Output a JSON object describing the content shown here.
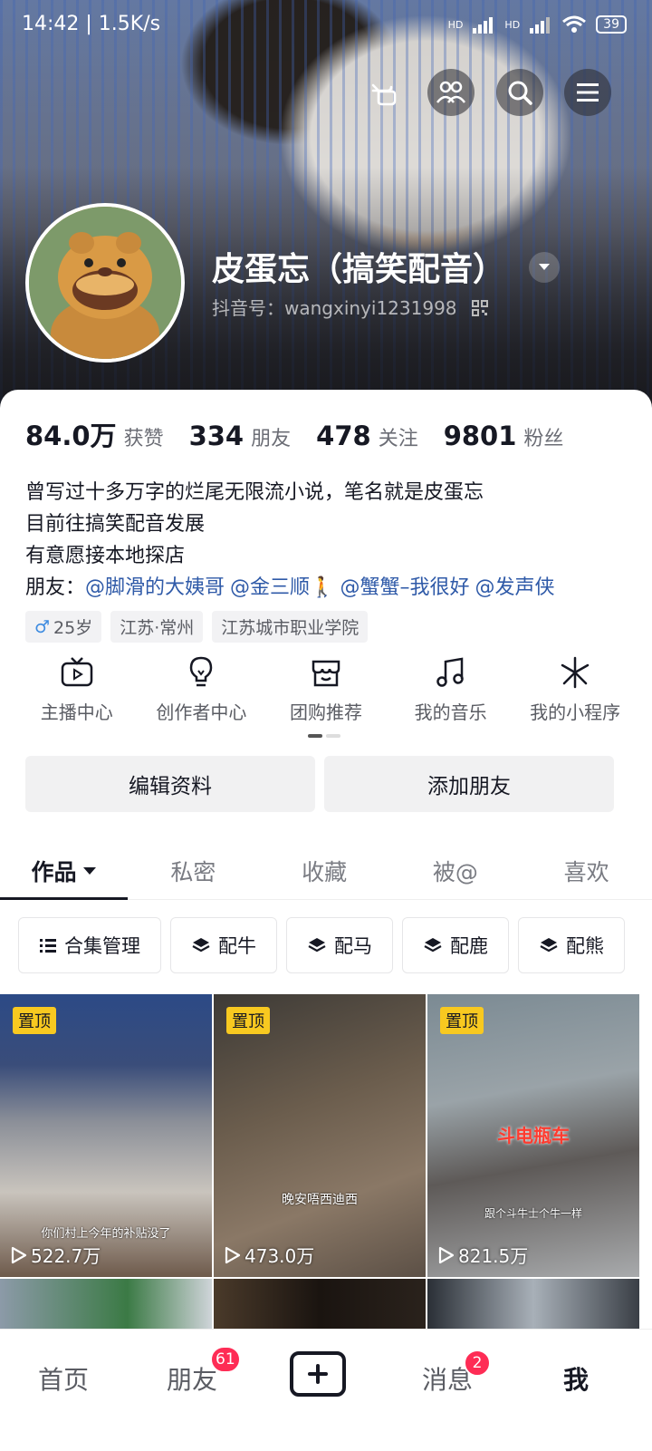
{
  "status_bar": {
    "time": "14:42 | 1.5K/s",
    "battery": "39",
    "net1": "HD",
    "net2": "HD"
  },
  "profile": {
    "name": "皮蛋忘（搞笑配音）",
    "douyin_id": "抖音号：wangxinyi1231998"
  },
  "stats": [
    {
      "value": "84.0万",
      "label": "获赞"
    },
    {
      "value": "334",
      "label": "朋友"
    },
    {
      "value": "478",
      "label": "关注"
    },
    {
      "value": "9801",
      "label": "粉丝"
    }
  ],
  "bio": {
    "line1": "曾写过十多万字的烂尾无限流小说，笔名就是皮蛋忘",
    "line2": "目前往搞笑配音发展",
    "line3": "有意愿接本地探店",
    "friends_label": "朋友：",
    "mentions": [
      "@脚滑的大姨哥",
      "@金三顺🚶",
      "@蟹蟹–我很好",
      "@发声侠"
    ]
  },
  "tags": {
    "age": "25岁",
    "location": "江苏·常州",
    "school": "江苏城市职业学院"
  },
  "shortcuts": [
    "主播中心",
    "创作者中心",
    "团购推荐",
    "我的音乐",
    "我的小程序"
  ],
  "actions": {
    "edit": "编辑资料",
    "add_friend": "添加朋友"
  },
  "tabs": [
    "作品",
    "私密",
    "收藏",
    "被@",
    "喜欢"
  ],
  "chips": [
    "合集管理",
    "配牛",
    "配马",
    "配鹿",
    "配熊"
  ],
  "videos": [
    {
      "pinned": "置顶",
      "plays": "522.7万",
      "caption": "你们村上今年的补贴没了"
    },
    {
      "pinned": "置顶",
      "plays": "473.0万",
      "caption": "晚安唔西迪西"
    },
    {
      "pinned": "置顶",
      "plays": "821.5万",
      "caption": "斗电瓶车",
      "caption2": "跟个斗牛士个牛一样"
    }
  ],
  "nav": {
    "home": "首页",
    "friends": "朋友",
    "friends_badge": "61",
    "messages": "消息",
    "messages_badge": "2",
    "me": "我"
  }
}
